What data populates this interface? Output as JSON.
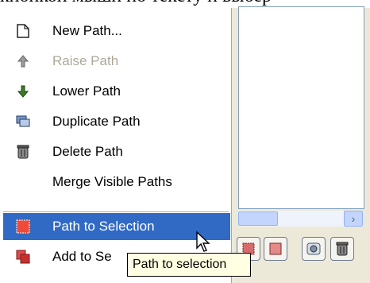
{
  "document": {
    "background_text": "кнопкой мыши по тексту и выбер"
  },
  "menu": {
    "items": [
      {
        "label": "New Path...",
        "icon": "new-path-icon",
        "enabled": true
      },
      {
        "label": "Raise Path",
        "icon": "raise-arrow-icon",
        "enabled": false
      },
      {
        "label": "Lower Path",
        "icon": "lower-arrow-icon",
        "enabled": true
      },
      {
        "label": "Duplicate Path",
        "icon": "duplicate-icon",
        "enabled": true
      },
      {
        "label": "Delete Path",
        "icon": "trash-icon",
        "enabled": true
      },
      {
        "label": "Merge Visible Paths",
        "icon": "",
        "enabled": true
      },
      {
        "label": "Path to Selection",
        "icon": "path-to-selection-icon",
        "enabled": true,
        "highlighted": true
      },
      {
        "label": "Add to Se",
        "icon": "add-to-selection-icon",
        "enabled": true
      }
    ]
  },
  "tooltip": {
    "text": "Path to selection"
  },
  "panel": {
    "scroll_right_glyph": "›",
    "buttons": [
      {
        "icon": "path-to-selection-button-icon"
      },
      {
        "icon": "paint-path-button-icon"
      },
      {
        "icon": "delete-button-icon"
      }
    ]
  },
  "colors": {
    "highlight": "#316ac5",
    "tooltip_bg": "#ffffe1",
    "disabled_text": "#aca899"
  }
}
